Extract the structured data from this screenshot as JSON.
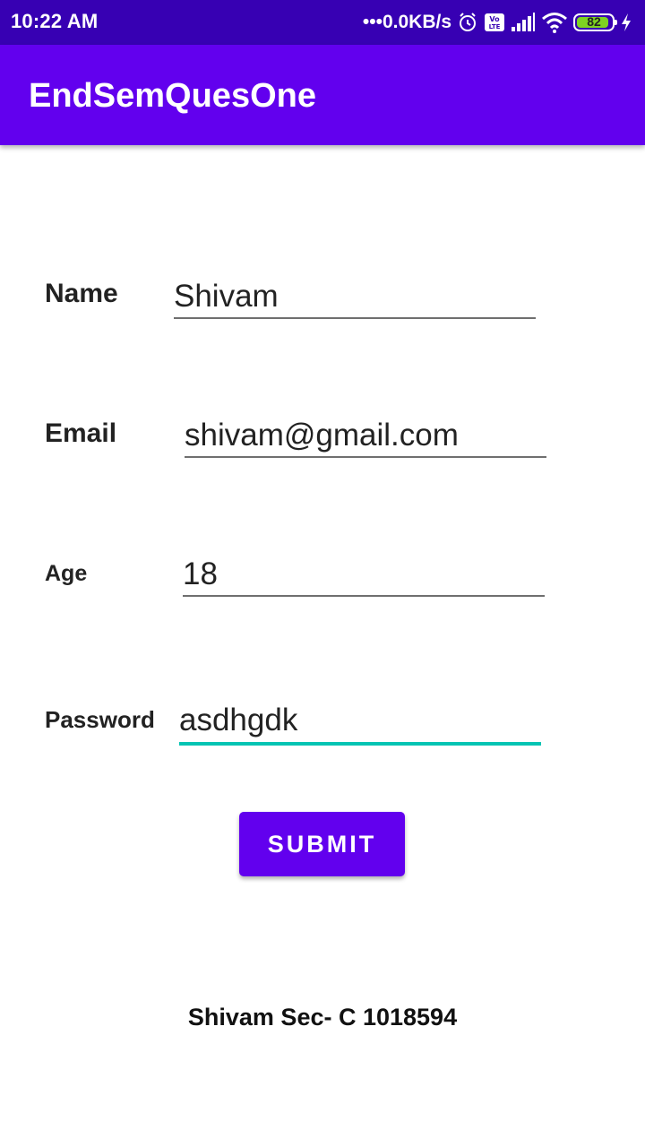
{
  "status_bar": {
    "time": "10:22 AM",
    "net_speed": "•••0.0KB/s",
    "battery_level": "82",
    "icons": [
      "alarm-icon",
      "volte-icon",
      "signal-icon",
      "wifi-icon",
      "battery-icon",
      "charging-icon"
    ]
  },
  "app_bar": {
    "title": "EndSemQuesOne"
  },
  "form": {
    "name": {
      "label": "Name",
      "value": "Shivam"
    },
    "email": {
      "label": "Email",
      "value": "shivam@gmail.com"
    },
    "age": {
      "label": "Age",
      "value": "18"
    },
    "password": {
      "label": "Password",
      "value": "asdhgdk"
    },
    "submit_label": "SUBMIT"
  },
  "footer": {
    "text": "Shivam Sec- C 1018594"
  },
  "colors": {
    "primary": "#6200ee",
    "primary_dark": "#3700b3",
    "accent": "#03c4b3",
    "battery": "#7ed321"
  }
}
